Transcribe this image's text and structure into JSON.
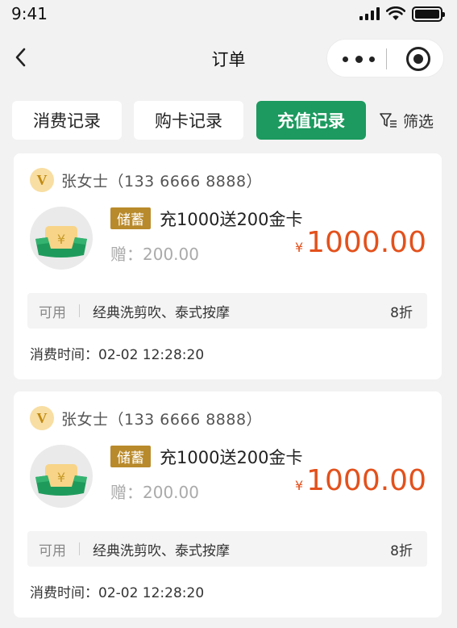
{
  "status_bar": {
    "time": "9:41"
  },
  "nav": {
    "title": "订单"
  },
  "tabs": [
    {
      "label": "消费记录",
      "active": false
    },
    {
      "label": "购卡记录",
      "active": false
    },
    {
      "label": "充值记录",
      "active": true
    }
  ],
  "filter": {
    "label": "筛选"
  },
  "orders": [
    {
      "vip_letter": "V",
      "customer": "张女士（133 6666 8888）",
      "card_icon": "card-yen-icon",
      "tag": "储蓄",
      "product": "充1000送200金卡",
      "bonus": "赠：200.00",
      "currency_symbol": "¥",
      "amount": "1000.00",
      "usage_label": "可用",
      "services": "经典洗剪吹、泰式按摩",
      "discount": "8折",
      "time": "消费时间：02-02 12:28:20"
    },
    {
      "vip_letter": "V",
      "customer": "张女士（133 6666 8888）",
      "card_icon": "card-yen-icon",
      "tag": "储蓄",
      "product": "充1000送200金卡",
      "bonus": "赠：200.00",
      "currency_symbol": "¥",
      "amount": "1000.00",
      "usage_label": "可用",
      "services": "经典洗剪吹、泰式按摩",
      "discount": "8折",
      "time": "消费时间：02-02 12:28:20"
    }
  ],
  "colors": {
    "accent": "#1c9a5f",
    "price": "#e3511c",
    "tag": "#b98a2b",
    "vip": "#f8dea2"
  }
}
